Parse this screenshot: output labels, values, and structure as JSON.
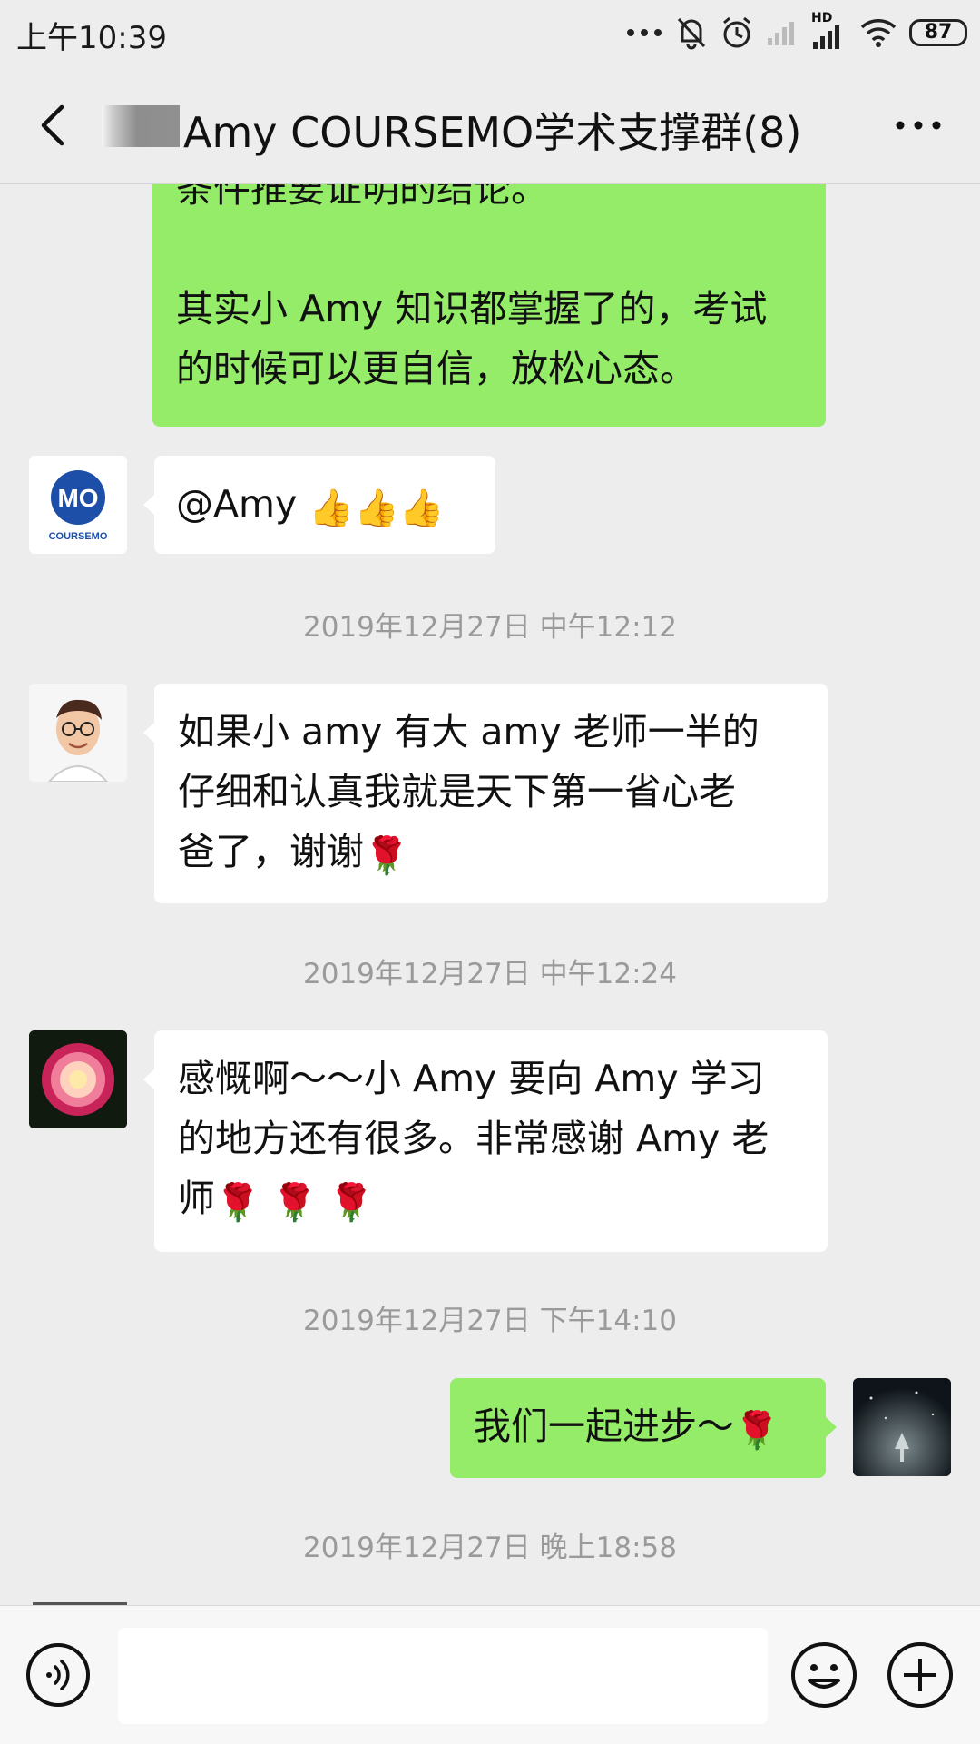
{
  "status_bar": {
    "time": "上午10:39",
    "battery": "87",
    "network_label": "HD"
  },
  "header": {
    "title": "Amy COURSEMO学术支撑群(8)"
  },
  "messages": [
    {
      "side": "right",
      "color": "green",
      "lines": [
        "条件推要证明的结论。",
        "",
        "其实小 Amy 知识都掌握了的，考试",
        "的时候可以更自信，放松心态。"
      ]
    },
    {
      "side": "left",
      "sender_avatar": "coursemo-logo",
      "logo_text": "MO",
      "logo_caption": "COURSEMO",
      "text": "@Amy",
      "emoji": "👍👍👍"
    },
    {
      "timestamp": "2019年12月27日 中午12:12"
    },
    {
      "side": "left",
      "sender_avatar": "cartoon-man-avatar",
      "lines": [
        "如果小 amy 有大 amy 老师一半的",
        "仔细和认真我就是天下第一省心老",
        "爸了，谢谢"
      ],
      "emoji": "🌹"
    },
    {
      "timestamp": "2019年12月27日 中午12:24"
    },
    {
      "side": "left",
      "sender_avatar": "rose-avatar",
      "lines": [
        "感慨啊～～小 Amy 要向 Amy 学习",
        "的地方还有很多。非常感谢 Amy 老",
        "师"
      ],
      "emoji": "🌹 🌹 🌹"
    },
    {
      "timestamp": "2019年12月27日 下午14:10"
    },
    {
      "side": "right",
      "color": "green",
      "text": "我们一起进步～",
      "emoji": "🌹",
      "sender_avatar": "night-scene-avatar"
    },
    {
      "timestamp": "2019年12月27日 晚上18:58"
    }
  ],
  "input_bar": {
    "placeholder": "",
    "value": ""
  },
  "colors": {
    "background": "#ededed",
    "bubble_green": "#95ec69",
    "bubble_white": "#ffffff",
    "timestamp": "#9a9a9a"
  }
}
